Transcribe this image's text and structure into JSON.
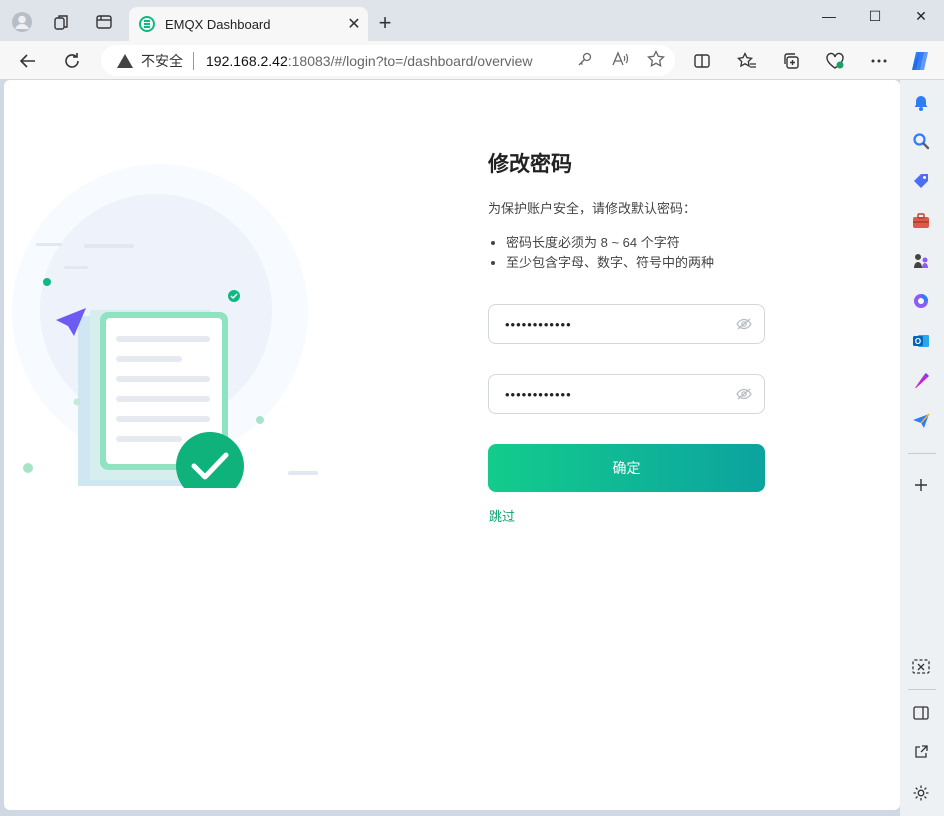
{
  "browser": {
    "tab_title": "EMQX Dashboard",
    "tab_close": "✕",
    "new_tab": "+",
    "insecure_label": "不安全",
    "url_host": "192.168.2.42",
    "url_rest": ":18083/#/login?to=/dashboard/overview",
    "window_controls": [
      "—",
      "☐",
      "✕"
    ]
  },
  "form": {
    "title": "修改密码",
    "description": "为保护账户安全，请修改默认密码：",
    "rules": [
      "密码长度必须为 8 ~ 64 个字符",
      "至少包含字母、数字、符号中的两种"
    ],
    "password_value": "••••••••••••",
    "confirm_value": "••••••••••••",
    "submit_label": "确定",
    "skip_label": "跳过"
  },
  "colors": {
    "accent": "#10b981",
    "button_start": "#13cc8c",
    "button_end": "#0ca39f",
    "link": "#0ca46f"
  }
}
